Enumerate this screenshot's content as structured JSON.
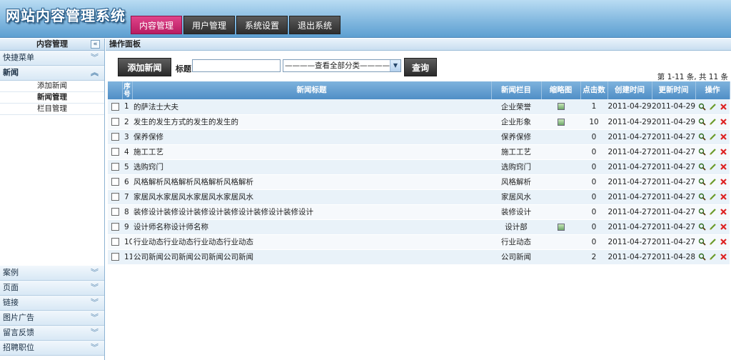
{
  "app": {
    "logo_text": "网站内容管理系统"
  },
  "topnav": [
    {
      "label": "内容管理",
      "active": true
    },
    {
      "label": "用户管理",
      "active": false
    },
    {
      "label": "系统设置",
      "active": false
    },
    {
      "label": "退出系统",
      "active": false
    }
  ],
  "sidebar": {
    "title": "内容管理",
    "collapse_icon": "«",
    "sections_top": [
      {
        "label": "快捷菜单",
        "chev": "︾"
      },
      {
        "label": "新闻",
        "chev": "︽"
      }
    ],
    "news_items": [
      {
        "label": "添加新闻"
      },
      {
        "label": "新闻管理"
      },
      {
        "label": "栏目管理"
      }
    ],
    "sections_bottom": [
      {
        "label": "案例",
        "chev": "︾"
      },
      {
        "label": "页面",
        "chev": "︾"
      },
      {
        "label": "链接",
        "chev": "︾"
      },
      {
        "label": "图片广告",
        "chev": "︾"
      },
      {
        "label": "留言反馈",
        "chev": "︾"
      },
      {
        "label": "招聘职位",
        "chev": "︾"
      }
    ]
  },
  "panel": {
    "title": "操作面板",
    "add_button": "添加新闻",
    "title_label": "标题",
    "title_value": "",
    "category_selected": "————查看全部分类————",
    "query_button": "查询",
    "pager_text": "第 1-11 条, 共 11 条"
  },
  "table": {
    "headers": {
      "seq": "序号",
      "title": "新闻标题",
      "category": "新闻栏目",
      "thumb": "缩略图",
      "clicks": "点击数",
      "created": "创建时间",
      "updated": "更新时间",
      "ops": "操作"
    },
    "rows": [
      {
        "n": "1",
        "title": "的萨法士大夫",
        "category": "企业荣誉",
        "thumb": true,
        "clicks": "1",
        "created": "2011-04-29",
        "updated": "2011-04-29"
      },
      {
        "n": "2",
        "title": "发生的发生方式的发生的发生的",
        "category": "企业形象",
        "thumb": true,
        "clicks": "10",
        "created": "2011-04-29",
        "updated": "2011-04-29"
      },
      {
        "n": "3",
        "title": "保养保修",
        "category": "保养保修",
        "thumb": false,
        "clicks": "0",
        "created": "2011-04-27",
        "updated": "2011-04-27"
      },
      {
        "n": "4",
        "title": "施工工艺",
        "category": "施工工艺",
        "thumb": false,
        "clicks": "0",
        "created": "2011-04-27",
        "updated": "2011-04-27"
      },
      {
        "n": "5",
        "title": "选购窍门",
        "category": "选购窍门",
        "thumb": false,
        "clicks": "0",
        "created": "2011-04-27",
        "updated": "2011-04-27"
      },
      {
        "n": "6",
        "title": "风格解析风格解析风格解析风格解析",
        "category": "风格解析",
        "thumb": false,
        "clicks": "0",
        "created": "2011-04-27",
        "updated": "2011-04-27"
      },
      {
        "n": "7",
        "title": "家居风水家居风水家居风水家居风水",
        "category": "家居风水",
        "thumb": false,
        "clicks": "0",
        "created": "2011-04-27",
        "updated": "2011-04-27"
      },
      {
        "n": "8",
        "title": "装修设计装修设计装修设计装修设计装修设计装修设计",
        "category": "装修设计",
        "thumb": false,
        "clicks": "0",
        "created": "2011-04-27",
        "updated": "2011-04-27"
      },
      {
        "n": "9",
        "title": "设计师名称设计师名称",
        "category": "设计部",
        "thumb": true,
        "clicks": "0",
        "created": "2011-04-27",
        "updated": "2011-04-27"
      },
      {
        "n": "10",
        "title": "行业动态行业动态行业动态行业动态",
        "category": "行业动态",
        "thumb": false,
        "clicks": "0",
        "created": "2011-04-27",
        "updated": "2011-04-27"
      },
      {
        "n": "11",
        "title": "公司新闻公司新闻公司新闻公司新闻",
        "category": "公司新闻",
        "thumb": false,
        "clicks": "2",
        "created": "2011-04-27",
        "updated": "2011-04-28"
      }
    ]
  },
  "icons": {
    "view": "magnifier-icon",
    "edit": "pencil-icon",
    "delete": "delete-x-icon"
  }
}
